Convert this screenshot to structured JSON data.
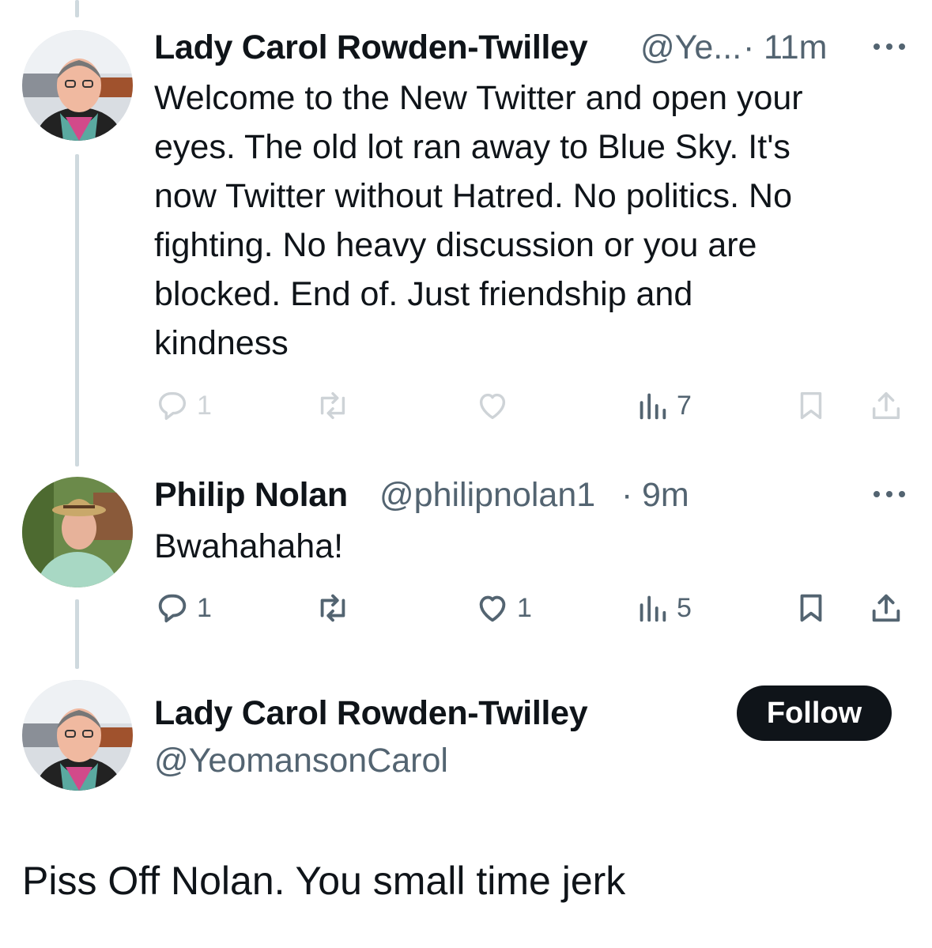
{
  "tweets": [
    {
      "author": "Lady Carol Rowden-Twilley",
      "handle": "@Ye...",
      "separator": "·",
      "time": "11m",
      "lines": [
        "Welcome to the New Twitter and open your",
        "eyes. The old lot ran away to Blue Sky. It's",
        "now Twitter without Hatred. No politics. No",
        "fighting. No heavy discussion or you are",
        "blocked. End of. Just friendship and",
        "kindness"
      ],
      "reply_count": "1",
      "retweet_count": "",
      "like_count": "",
      "view_count": "7"
    },
    {
      "author": "Philip Nolan",
      "handle": "@philipnolan1",
      "separator": "·",
      "time": "9m",
      "lines": [
        "Bwahahaha!"
      ],
      "reply_count": "1",
      "retweet_count": "",
      "like_count": "1",
      "view_count": "5"
    }
  ],
  "focused": {
    "author": "Lady Carol Rowden-Twilley",
    "handle": "@YeomansonCarol",
    "follow_label": "Follow",
    "text": "Piss Off Nolan. You small time jerk"
  },
  "icons": {
    "reply": "reply-icon",
    "retweet": "retweet-icon",
    "like": "heart-icon",
    "views": "views-icon",
    "bookmark": "bookmark-icon",
    "share": "share-icon",
    "more": "more-icon"
  },
  "colors": {
    "text": "#0f1419",
    "secondary": "#536471",
    "thread_line": "#cfd9de",
    "button": "#0f1419"
  }
}
